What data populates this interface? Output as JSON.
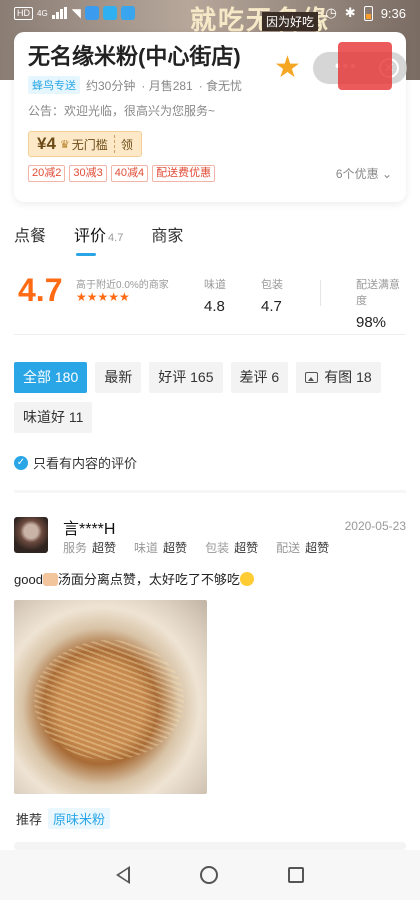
{
  "banner": {
    "promo_text": "就吃无名缘",
    "promo_sub": "因为好吃"
  },
  "status_bar": {
    "time": "9:36",
    "hd": "HD",
    "net": "4G"
  },
  "shop": {
    "name": "无名缘米粉(中心街店)",
    "delivery_tag": "蜂鸟专送",
    "delivery_time": "约30分钟",
    "monthly_sales": "· 月售281",
    "safety": "· 食无忧",
    "notice": "公告：欢迎光临，很高兴为您服务~",
    "coupon": {
      "amount": "¥4",
      "condition": "无门槛",
      "action": "领"
    },
    "promos": [
      "20减2",
      "30减3",
      "40减4",
      "配送费优惠"
    ],
    "promo_more": "6个优惠"
  },
  "tabs": [
    {
      "label": "点餐",
      "sub": ""
    },
    {
      "label": "评价",
      "sub": "4.7"
    },
    {
      "label": "商家",
      "sub": ""
    }
  ],
  "rating": {
    "score": "4.7",
    "rank_text": "高于附近0.0%的商家",
    "stars": "★★★★★",
    "taste": {
      "label": "味道",
      "value": "4.8"
    },
    "packaging": {
      "label": "包装",
      "value": "4.7"
    },
    "delivery": {
      "label": "配送满意度",
      "value": "98%"
    }
  },
  "filters": [
    {
      "label": "全部 180",
      "active": true
    },
    {
      "label": "最新",
      "active": false
    },
    {
      "label": "好评 165",
      "active": false
    },
    {
      "label": "差评 6",
      "active": false
    },
    {
      "label": "有图 18",
      "active": false,
      "icon": "image-icon"
    },
    {
      "label": "味道好 11",
      "active": false
    }
  ],
  "only_content": "只看有内容的评价",
  "review": {
    "user": "言****H",
    "date": "2020-05-23",
    "scores": [
      {
        "k": "服务",
        "v": "超赞"
      },
      {
        "k": "味道",
        "v": "超赞"
      },
      {
        "k": "包装",
        "v": "超赞"
      },
      {
        "k": "配送",
        "v": "超赞"
      }
    ],
    "text_before": "good",
    "text_after": "汤面分离点赞，太好吃了不够吃",
    "recommend_label": "推荐",
    "recommend_item": "原味米粉"
  },
  "colors": {
    "accent": "#2aa6e6",
    "score": "#ff6a13",
    "promo": "#e14b35"
  }
}
